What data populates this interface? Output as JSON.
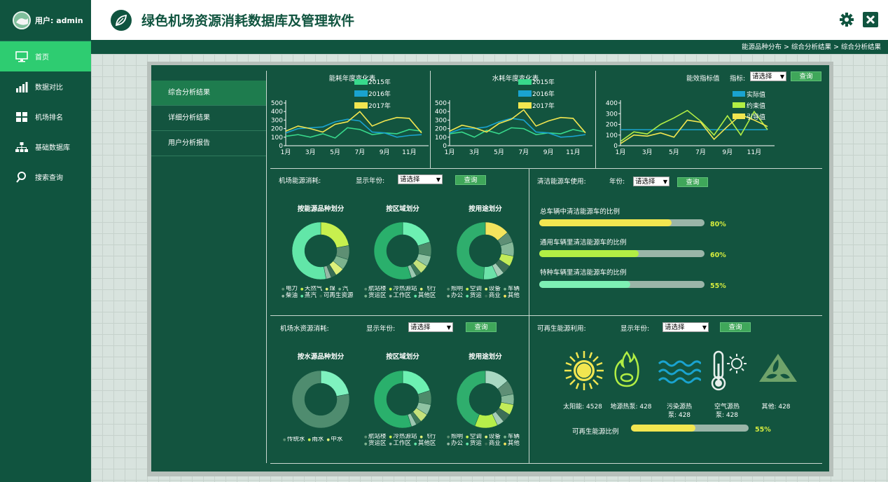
{
  "sidebar": {
    "user_label": "用户: admin",
    "items": [
      {
        "label": "首页",
        "icon": "monitor-icon"
      },
      {
        "label": "数据对比",
        "icon": "bar-chart-icon"
      },
      {
        "label": "机场排名",
        "icon": "grid-icon"
      },
      {
        "label": "基础数据库",
        "icon": "hierarchy-icon"
      },
      {
        "label": "搜索查询",
        "icon": "search-icon"
      }
    ]
  },
  "header": {
    "title": "绿色机场资源消耗数据库及管理软件"
  },
  "breadcrumb": "能源品种分布 > 综合分析结果 > 综合分析结果",
  "subnav": [
    "综合分析结果",
    "详细分析结果",
    "用户分析报告"
  ],
  "colors": {
    "accent": "#2ecc71",
    "sidebar": "#10543f",
    "panel": "#13543f",
    "y2015": "#38d98c",
    "y2016": "#1aa3cf",
    "y2017": "#f2e650",
    "lime": "#b2ee44"
  },
  "chart_data": [
    {
      "type": "line",
      "title": "能耗年度变化表",
      "x": [
        "1月",
        "2月",
        "3月",
        "4月",
        "5月",
        "6月",
        "7月",
        "8月",
        "9月",
        "10月",
        "11月",
        "12月"
      ],
      "xticks": [
        "1月",
        "3月",
        "5月",
        "7月",
        "9月",
        "11月"
      ],
      "yticks": [
        "0",
        "100",
        "200",
        "300",
        "400",
        "500"
      ],
      "ylim": [
        0,
        500
      ],
      "series": [
        {
          "name": "2015年",
          "values": [
            110,
            130,
            100,
            140,
            90,
            210,
            190,
            130,
            150,
            140,
            190,
            170
          ]
        },
        {
          "name": "2016年",
          "values": [
            150,
            200,
            210,
            220,
            280,
            310,
            290,
            160,
            150,
            100,
            120,
            130
          ]
        },
        {
          "name": "2017年",
          "values": [
            170,
            230,
            200,
            160,
            250,
            280,
            400,
            230,
            290,
            330,
            320,
            150
          ]
        }
      ]
    },
    {
      "type": "line",
      "title": "水耗年度变化表",
      "x": [
        "1月",
        "2月",
        "3月",
        "4月",
        "5月",
        "6月",
        "7月",
        "8月",
        "9月",
        "10月",
        "11月",
        "12月"
      ],
      "xticks": [
        "1月",
        "3月",
        "5月",
        "7月",
        "9月",
        "11月"
      ],
      "yticks": [
        "0",
        "100",
        "200",
        "300",
        "400",
        "500"
      ],
      "ylim": [
        0,
        500
      ],
      "series": [
        {
          "name": "2015年",
          "values": [
            140,
            160,
            100,
            180,
            140,
            210,
            200,
            130,
            150,
            140,
            190,
            160
          ]
        },
        {
          "name": "2016年",
          "values": [
            150,
            200,
            200,
            220,
            280,
            320,
            300,
            160,
            150,
            100,
            110,
            130
          ]
        },
        {
          "name": "2017年",
          "values": [
            170,
            240,
            210,
            160,
            260,
            310,
            420,
            230,
            290,
            330,
            320,
            150
          ]
        }
      ]
    },
    {
      "type": "line",
      "title": "能效指标值",
      "x": [
        "1月",
        "2月",
        "3月",
        "4月",
        "5月",
        "6月",
        "7月",
        "8月",
        "9月",
        "10月",
        "11月",
        "12月"
      ],
      "xticks": [
        "1月",
        "3月",
        "5月",
        "7月",
        "9月",
        "11月"
      ],
      "yticks": [
        "0",
        "100",
        "200",
        "300",
        "400"
      ],
      "ylim": [
        0,
        400
      ],
      "series": [
        {
          "name": "实际值",
          "values": [
            150,
            150,
            150,
            150,
            150,
            150,
            150,
            150,
            150,
            150,
            150,
            150
          ]
        },
        {
          "name": "约束值",
          "values": [
            40,
            130,
            110,
            200,
            260,
            330,
            230,
            100,
            280,
            100,
            320,
            150
          ]
        },
        {
          "name": "引导值",
          "values": [
            20,
            100,
            90,
            120,
            80,
            240,
            220,
            60,
            180,
            290,
            240,
            180
          ]
        }
      ]
    },
    {
      "type": "pie",
      "title": "按能源品种划分",
      "series": [
        {
          "name": "",
          "values": [
            22,
            8,
            6,
            5,
            3,
            3,
            53
          ]
        }
      ]
    },
    {
      "type": "pie",
      "title": "按区域划分",
      "series": [
        {
          "name": "",
          "values": [
            20,
            8,
            6,
            5,
            3,
            3,
            55
          ]
        }
      ]
    },
    {
      "type": "pie",
      "title": "按用途划分",
      "series": [
        {
          "name": "",
          "values": [
            14,
            6,
            8,
            6,
            5,
            4,
            8,
            49
          ]
        }
      ]
    },
    {
      "type": "pie",
      "title": "按水源品种划分",
      "series": [
        {
          "name": "",
          "values": [
            22,
            78
          ]
        }
      ]
    },
    {
      "type": "pie",
      "title": "按区域划分",
      "series": [
        {
          "name": "",
          "values": [
            20,
            8,
            6,
            5,
            3,
            3,
            55
          ]
        }
      ]
    },
    {
      "type": "pie",
      "title": "按用途划分",
      "series": [
        {
          "name": "",
          "values": [
            14,
            8,
            6,
            6,
            5,
            4,
            13,
            44
          ]
        }
      ]
    }
  ],
  "top_charts": {
    "energy_title": "能耗年度变化表",
    "water_title": "水耗年度变化表",
    "eff_title": "能效指标值",
    "eff_metric_label": "指标:",
    "legend_years": [
      "2015年",
      "2016年",
      "2017年"
    ],
    "legend_eff": [
      "实际值",
      "约束值",
      "引导值"
    ]
  },
  "common": {
    "select_default": "请选择",
    "query_btn": "查询",
    "show_year": "显示年份:",
    "year": "年份:"
  },
  "energy_section": {
    "title": "机场能源消耗:",
    "donuts": [
      "按能源品种划分",
      "按区域划分",
      "按用途划分"
    ],
    "legend1": [
      "电力",
      "天然气",
      "煤",
      "汽",
      "柴油",
      "蒸汽",
      "可再生资源"
    ],
    "legend2": [
      "航站楼",
      "冷热源站",
      "飞行",
      "货运区",
      "工作区",
      "其他区"
    ],
    "legend3": [
      "照明",
      "空调",
      "设备",
      "车辆",
      "办公",
      "货运",
      "商业",
      "其他"
    ]
  },
  "water_section": {
    "title": "机场水资源消耗:",
    "donuts": [
      "按水源品种划分",
      "按区域划分",
      "按用途划分"
    ],
    "legend1": [
      "传统水",
      "雨水",
      "中水"
    ],
    "legend2": [
      "航站楼",
      "冷热源站",
      "飞行",
      "货运区",
      "工作区",
      "其他区"
    ],
    "legend3": [
      "照明",
      "空调",
      "设备",
      "车辆",
      "办公",
      "货运",
      "商业",
      "其他"
    ]
  },
  "clean_section": {
    "title": "清洁能源车使用:",
    "bars": [
      {
        "label": "总车辆中清洁能源车的比例",
        "value": 80,
        "display": "80%",
        "color": "#f2e650"
      },
      {
        "label": "通用车辆里清洁能源车的比例",
        "value": 60,
        "display": "60%",
        "color": "#b2ee44"
      },
      {
        "label": "特种车辆里清洁能源车的比例",
        "value": 55,
        "display": "55%",
        "color": "#7df0b4"
      }
    ]
  },
  "renew_section": {
    "title": "可再生能源利用:",
    "items": [
      {
        "l1": "太阳能: 4528",
        "l2": "",
        "icon": "sun-icon"
      },
      {
        "l1": "地源热泵: 428",
        "l2": "",
        "icon": "flame-icon"
      },
      {
        "l1": "污染源热",
        "l2": "泵: 428",
        "icon": "waves-icon"
      },
      {
        "l1": "空气源热",
        "l2": "泵: 428",
        "icon": "thermometer-icon"
      },
      {
        "l1": "其他: 428",
        "l2": "",
        "icon": "leaf-recycle-icon"
      }
    ],
    "ratio_label": "可再生能源比例",
    "ratio": 55,
    "ratio_display": "55%"
  }
}
